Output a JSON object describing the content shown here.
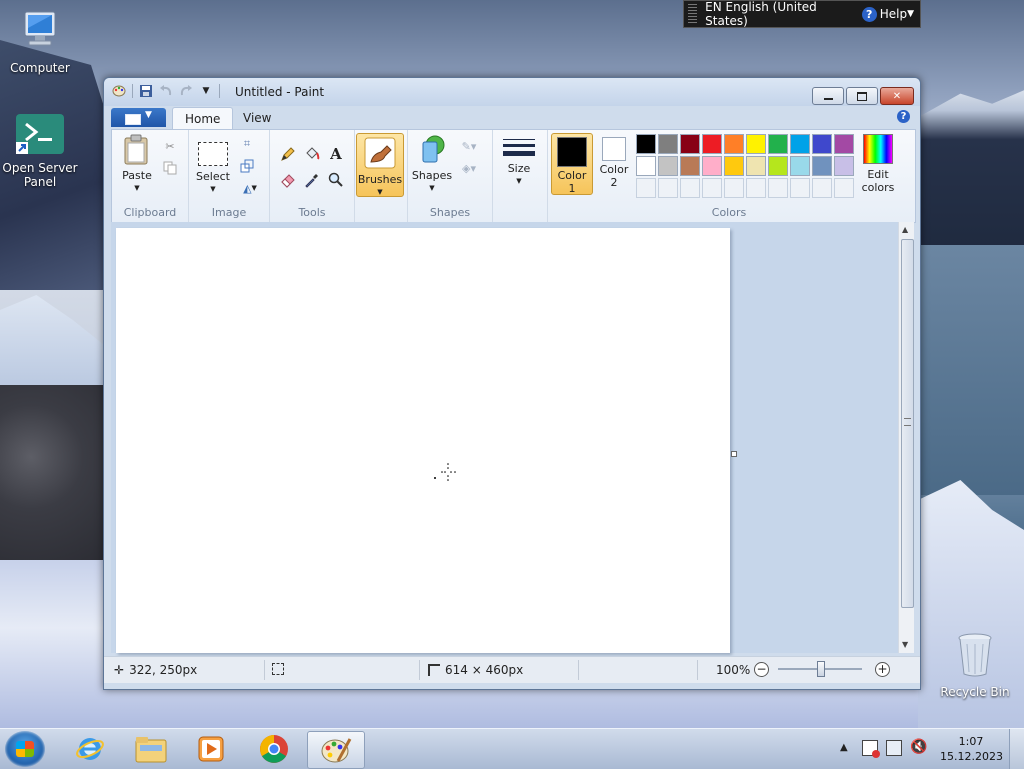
{
  "langbar": {
    "language": "EN English (United States)",
    "help": "Help"
  },
  "desktop_icons": [
    {
      "label": "Computer"
    },
    {
      "label": "Open Server Panel"
    },
    {
      "label": "Recycle Bin"
    }
  ],
  "window": {
    "title": "Untitled - Paint",
    "tabs": {
      "home": "Home",
      "view": "View"
    }
  },
  "ribbon": {
    "clipboard": {
      "paste": "Paste",
      "group": "Clipboard"
    },
    "image": {
      "select": "Select",
      "group": "Image"
    },
    "tools": {
      "group": "Tools"
    },
    "brushes": {
      "label": "Brushes"
    },
    "shapes": {
      "label": "Shapes",
      "group": "Shapes"
    },
    "size": {
      "label": "Size"
    },
    "colors": {
      "color1": "Color 1",
      "color2": "Color 2",
      "edit": "Edit colors",
      "group": "Colors",
      "color1_value": "#000000",
      "color2_value": "#ffffff",
      "palette_row1": [
        "#000000",
        "#7f7f7f",
        "#880015",
        "#ed1c24",
        "#ff7f27",
        "#fff200",
        "#22b14c",
        "#00a2e8",
        "#3f48cc",
        "#a349a4"
      ],
      "palette_row2": [
        "#ffffff",
        "#c3c3c3",
        "#b97a57",
        "#ffaec9",
        "#ffc90e",
        "#efe4b0",
        "#b5e61d",
        "#99d9ea",
        "#7092be",
        "#c8bfe7"
      ]
    }
  },
  "status": {
    "cursor_pos": "322, 250px",
    "image_size": "614 × 460px",
    "zoom": "100%"
  },
  "taskbar": {
    "time": "1:07",
    "date": "15.12.2023"
  }
}
